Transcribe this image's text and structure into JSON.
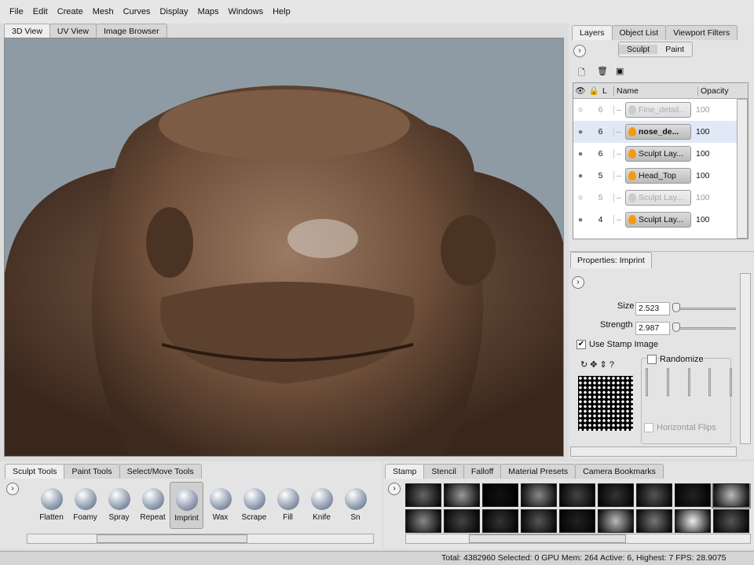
{
  "menu": [
    "File",
    "Edit",
    "Create",
    "Mesh",
    "Curves",
    "Display",
    "Maps",
    "Windows",
    "Help"
  ],
  "view_tabs": [
    "3D View",
    "UV View",
    "Image Browser"
  ],
  "right_tabs": [
    "Layers",
    "Object List",
    "Viewport Filters"
  ],
  "layer_modes": [
    "Sculpt",
    "Paint"
  ],
  "layer_columns": {
    "l": "L",
    "name": "Name",
    "opacity": "Opacity"
  },
  "layers": [
    {
      "level": "6",
      "name": "Fine_detail...",
      "opacity": "100",
      "visible": false,
      "selected": false
    },
    {
      "level": "6",
      "name": "nose_de...",
      "opacity": "100",
      "visible": true,
      "selected": true
    },
    {
      "level": "6",
      "name": "Sculpt Lay...",
      "opacity": "100",
      "visible": true,
      "selected": false
    },
    {
      "level": "5",
      "name": "Head_Top",
      "opacity": "100",
      "visible": true,
      "selected": false
    },
    {
      "level": "5",
      "name": "Sculpt Lay...",
      "opacity": "100",
      "visible": false,
      "selected": false
    },
    {
      "level": "4",
      "name": "Sculpt Lay...",
      "opacity": "100",
      "visible": true,
      "selected": false
    }
  ],
  "properties": {
    "title": "Properties: Imprint",
    "size_label": "Size",
    "size": "2.523",
    "strength_label": "Strength",
    "strength": "2.987",
    "use_stamp": "Use Stamp Image",
    "randomize": "Randomize",
    "hflips": "Horizontal Flips"
  },
  "tool_tabs": [
    "Sculpt Tools",
    "Paint Tools",
    "Select/Move Tools"
  ],
  "tools": [
    "Flatten",
    "Foamy",
    "Spray",
    "Repeat",
    "Imprint",
    "Wax",
    "Scrape",
    "Fill",
    "Knife",
    "Sn"
  ],
  "stamp_tabs": [
    "Stamp",
    "Stencil",
    "Falloff",
    "Material Presets",
    "Camera Bookmarks"
  ],
  "status": "Total: 4382960  Selected: 0 GPU Mem: 264  Active: 6, Highest: 7  FPS: 28.9075"
}
